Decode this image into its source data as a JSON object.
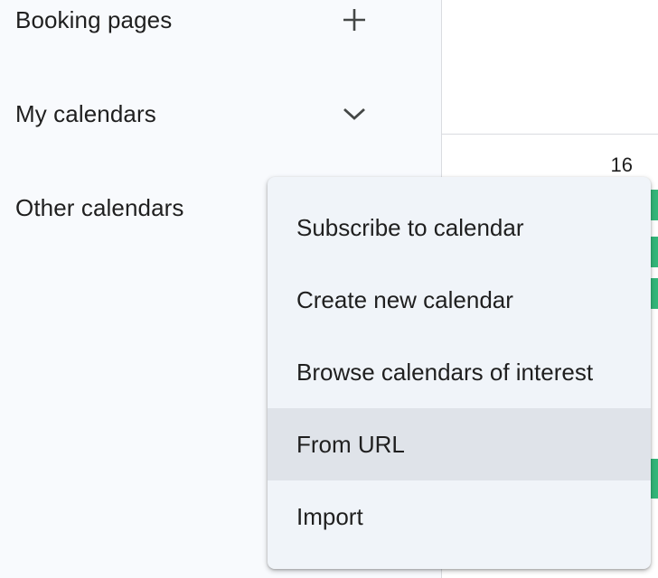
{
  "sidebar": {
    "booking_pages": {
      "label": "Booking pages",
      "icon": "plus-icon"
    },
    "my_calendars": {
      "label": "My calendars",
      "icon": "chevron-down-icon"
    },
    "other_calendars": {
      "label": "Other calendars"
    }
  },
  "main": {
    "date_number": "16"
  },
  "menu": {
    "items": [
      {
        "label": "Subscribe to calendar"
      },
      {
        "label": "Create new calendar"
      },
      {
        "label": "Browse calendars of interest"
      },
      {
        "label": "From URL",
        "hovered": true
      },
      {
        "label": "Import"
      }
    ]
  },
  "colors": {
    "sidebar_bg": "#f8fafd",
    "menu_bg": "#f0f4f9",
    "menu_hover": "#dfe3e9",
    "event_green": "#33b679"
  }
}
